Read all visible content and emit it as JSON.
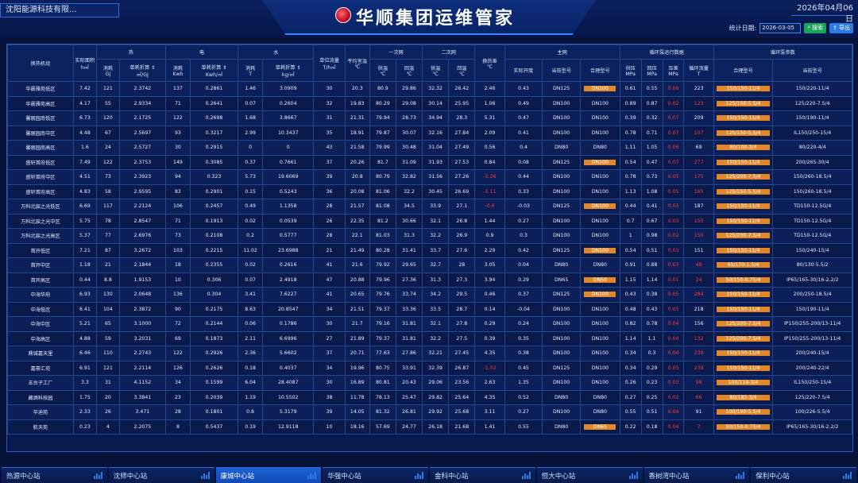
{
  "header": {
    "company": "沈阳能源科技有限...",
    "title": "华顺集团运维管家",
    "date": "2026年04月06日"
  },
  "filter": {
    "label": "统计日期:",
    "date_value": "2026-03-05",
    "search_label": "搜索",
    "export_label": "导出"
  },
  "table": {
    "headers": {
      "station": "换热机组",
      "area": "实际面积",
      "area_unit": "h㎡",
      "heat": "热",
      "elec": "电",
      "water": "水",
      "unit_flow": "单位流量",
      "unit_flow_unit": "T/h㎡",
      "avg_temp": "平均室温",
      "avg_temp_unit": "℃",
      "primary": "一次网",
      "secondary": "二次网",
      "temp_diff": "换热差",
      "temp_diff_unit": "℃",
      "main_net": "主网",
      "pump_run": "循环泵运行数据",
      "pump_param": "循环泵参数",
      "heat_cons": "消耗",
      "heat_cons_unit": "GJ",
      "heat_unit": "单耗折算",
      "heat_unit_unit": "㎡/GJ",
      "elec_cons": "消耗",
      "elec_cons_unit": "Kwh",
      "elec_unit": "单耗折算",
      "elec_unit_unit": "Kwh/㎡",
      "water_cons": "消耗",
      "water_cons_unit": "T",
      "water_unit": "单耗折算",
      "water_unit_unit": "kg/㎡",
      "p_supply": "供温",
      "p_supply_unit": "℃",
      "p_return": "回温",
      "p_return_unit": "℃",
      "s_supply": "供温",
      "s_supply_unit": "℃",
      "s_return": "回温",
      "s_return_unit": "℃",
      "valve_open": "实际开度",
      "current_model": "当前型号",
      "proper_model": "合理型号",
      "out_press": "供压",
      "out_press_unit": "MPa",
      "ret_press": "回压",
      "ret_press_unit": "MPa",
      "diff_press": "压差",
      "diff_press_unit": "MPa",
      "flow": "循环流量",
      "flow_unit": "T",
      "pump_proper": "合理型号",
      "pump_current": "当前型号"
    },
    "rows": [
      {
        "name": "华晨雅苑低区",
        "area": "7.42",
        "hc": "121",
        "hu": "2.3742",
        "ec": "137",
        "eu": "0.2861",
        "wc": "1.46",
        "wu": "3.0909",
        "uf": "30",
        "at": "20.3",
        "ps": "80.9",
        "pr": "29.86",
        "ss": "32.32",
        "sr": "26.42",
        "td": "2.46",
        "vo": "0.43",
        "cm": "DN125",
        "pm": "DN100",
        "op": "0.61",
        "rp": "0.55",
        "dp": "0.06",
        "fl": "223",
        "pp": "150/150-11/4",
        "pc": "150/220-11/4",
        "orange_pm": true,
        "red_td": false,
        "red_dp": true,
        "red_fl": false
      },
      {
        "name": "华晨雅苑高区",
        "area": "4.17",
        "hc": "55",
        "hu": "2.9334",
        "ec": "71",
        "eu": "0.2641",
        "wc": "0.07",
        "wu": "0.2604",
        "uf": "32",
        "at": "19.83",
        "ps": "80.29",
        "pr": "29.08",
        "ss": "30.14",
        "sr": "25.95",
        "td": "1.06",
        "vo": "0.49",
        "cm": "DN100",
        "pm": "DN100",
        "op": "0.89",
        "rp": "0.87",
        "dp": "0.02",
        "fl": "123",
        "pp": "125/150-5.5/4",
        "pc": "125/220-7.5/4",
        "orange_pm": false,
        "red_td": false,
        "red_dp": true,
        "red_fl": true
      },
      {
        "name": "馨丽园南低区",
        "area": "6.73",
        "hc": "120",
        "hu": "2.1725",
        "ec": "122",
        "eu": "0.2698",
        "wc": "1.68",
        "wu": "3.8667",
        "uf": "31",
        "at": "21.31",
        "ps": "79.94",
        "pr": "28.73",
        "ss": "34.94",
        "sr": "28.3",
        "td": "5.31",
        "vo": "0.47",
        "cm": "DN100",
        "pm": "DN100",
        "op": "0.39",
        "rp": "0.32",
        "dp": "0.07",
        "fl": "209",
        "pp": "150/150-11/4",
        "pc": "150/190-11/4",
        "orange_pm": false,
        "red_td": false,
        "red_dp": true,
        "red_fl": false
      },
      {
        "name": "馨丽园南中区",
        "area": "4.48",
        "hc": "67",
        "hu": "2.5697",
        "ec": "93",
        "eu": "0.3217",
        "wc": "2.99",
        "wu": "10.3437",
        "uf": "35",
        "at": "18.91",
        "ps": "79.87",
        "pr": "30.07",
        "ss": "32.16",
        "sr": "27.84",
        "td": "2.09",
        "vo": "0.41",
        "cm": "DN100",
        "pm": "DN100",
        "op": "0.78",
        "rp": "0.71",
        "dp": "0.07",
        "fl": "107",
        "pp": "125/150-5.5/4",
        "pc": "IL150/250-15/4",
        "orange_pm": false,
        "red_td": false,
        "red_dp": true,
        "red_fl": true
      },
      {
        "name": "馨丽园南高区",
        "area": "1.6",
        "hc": "24",
        "hu": "2.5727",
        "ec": "30",
        "eu": "0.2915",
        "wc": "0",
        "wu": "0",
        "uf": "43",
        "at": "21.58",
        "ps": "79.99",
        "pr": "30.48",
        "ss": "31.04",
        "sr": "27.49",
        "td": "0.56",
        "vo": "0.4",
        "cm": "DN80",
        "pm": "DN80",
        "op": "1.11",
        "rp": "1.05",
        "dp": "0.06",
        "fl": "69",
        "pp": "80/100-3/4",
        "pc": "80/220-4/4",
        "orange_pm": false,
        "red_td": false,
        "red_dp": true,
        "red_fl": false
      },
      {
        "name": "盛轩首府低区",
        "area": "7.49",
        "hc": "122",
        "hu": "2.3753",
        "ec": "149",
        "eu": "0.3085",
        "wc": "0.37",
        "wu": "0.7661",
        "uf": "37",
        "at": "20.26",
        "ps": "81.7",
        "pr": "31.09",
        "ss": "31.93",
        "sr": "27.53",
        "td": "0.84",
        "vo": "0.08",
        "cm": "DN125",
        "pm": "DN100",
        "op": "0.54",
        "rp": "0.47",
        "dp": "0.07",
        "fl": "277",
        "pp": "150/150-11/4",
        "pc": "200/265-30/4",
        "orange_pm": true,
        "red_td": false,
        "red_dp": true,
        "red_fl": true
      },
      {
        "name": "盛轩首府中区",
        "area": "4.51",
        "hc": "73",
        "hu": "2.3923",
        "ec": "94",
        "eu": "0.323",
        "wc": "5.73",
        "wu": "19.6069",
        "uf": "39",
        "at": "20.8",
        "ps": "80.79",
        "pr": "32.82",
        "ss": "31.56",
        "sr": "27.26",
        "td": "-1.26",
        "vo": "0.44",
        "cm": "DN100",
        "pm": "DN100",
        "op": "0.78",
        "rp": "0.73",
        "dp": "0.05",
        "fl": "175",
        "pp": "125/200-7.5/4",
        "pc": "150/260-18.5/4",
        "orange_pm": false,
        "red_td": true,
        "red_dp": true,
        "red_fl": true
      },
      {
        "name": "盛轩首府高区",
        "area": "4.83",
        "hc": "58",
        "hu": "2.9595",
        "ec": "83",
        "eu": "0.2901",
        "wc": "0.15",
        "wu": "0.5243",
        "uf": "36",
        "at": "20.08",
        "ps": "81.06",
        "pr": "32.2",
        "ss": "30.45",
        "sr": "26.69",
        "td": "-1.11",
        "vo": "0.33",
        "cm": "DN100",
        "pm": "DN100",
        "op": "1.13",
        "rp": "1.08",
        "dp": "0.05",
        "fl": "165",
        "pp": "125/150-5.5/4",
        "pc": "150/260-18.5/4",
        "orange_pm": false,
        "red_td": true,
        "red_dp": true,
        "red_fl": true
      },
      {
        "name": "万科北宸之光低区",
        "area": "6.69",
        "hc": "117",
        "hu": "2.2124",
        "ec": "106",
        "eu": "0.2457",
        "wc": "0.49",
        "wu": "1.1358",
        "uf": "28",
        "at": "21.57",
        "ps": "81.08",
        "pr": "34.5",
        "ss": "33.9",
        "sr": "27.1",
        "td": "-0.6",
        "vo": "-0.03",
        "cm": "DN125",
        "pm": "DN100",
        "op": "0.44",
        "rp": "0.41",
        "dp": "0.03",
        "fl": "187",
        "pp": "150/150-11/4",
        "pc": "TD150-12.5G/4",
        "orange_pm": true,
        "red_td": true,
        "red_dp": true,
        "red_fl": false
      },
      {
        "name": "万科北宸之光中区",
        "area": "5.75",
        "hc": "78",
        "hu": "2.8547",
        "ec": "71",
        "eu": "0.1913",
        "wc": "0.02",
        "wu": "0.0539",
        "uf": "26",
        "at": "22.35",
        "ps": "81.2",
        "pr": "30.66",
        "ss": "32.1",
        "sr": "26.8",
        "td": "1.44",
        "vo": "0.27",
        "cm": "DN100",
        "pm": "DN100",
        "op": "0.7",
        "rp": "0.67",
        "dp": "0.03",
        "fl": "155",
        "pp": "150/150-11/4",
        "pc": "TD150-12.5G/4",
        "orange_pm": false,
        "red_td": false,
        "red_dp": true,
        "red_fl": true
      },
      {
        "name": "万科北宸之光高区",
        "area": "5.37",
        "hc": "77",
        "hu": "2.6976",
        "ec": "73",
        "eu": "0.2108",
        "wc": "0.2",
        "wu": "0.5777",
        "uf": "28",
        "at": "22.1",
        "ps": "81.03",
        "pr": "31.3",
        "ss": "32.2",
        "sr": "26.9",
        "td": "0.9",
        "vo": "0.3",
        "cm": "DN100",
        "pm": "DN100",
        "op": "1",
        "rp": "0.98",
        "dp": "0.02",
        "fl": "150",
        "pp": "125/200-7.5/4",
        "pc": "TD150-12.5G/4",
        "orange_pm": false,
        "red_td": false,
        "red_dp": true,
        "red_fl": true
      },
      {
        "name": "首开低区",
        "area": "7.21",
        "hc": "87",
        "hu": "3.2672",
        "ec": "103",
        "eu": "0.2215",
        "wc": "11.02",
        "wu": "23.6988",
        "uf": "21",
        "at": "21.49",
        "ps": "80.28",
        "pr": "31.41",
        "ss": "33.7",
        "sr": "27.6",
        "td": "2.29",
        "vo": "0.42",
        "cm": "DN125",
        "pm": "DN100",
        "op": "0.54",
        "rp": "0.51",
        "dp": "0.03",
        "fl": "151",
        "pp": "150/150-11/4",
        "pc": "150/240-15/4",
        "orange_pm": true,
        "red_td": false,
        "red_dp": true,
        "red_fl": false
      },
      {
        "name": "首开中区",
        "area": "1.18",
        "hc": "21",
        "hu": "2.1844",
        "ec": "18",
        "eu": "0.2355",
        "wc": "0.02",
        "wu": "0.2616",
        "uf": "41",
        "at": "21.6",
        "ps": "79.92",
        "pr": "29.65",
        "ss": "32.7",
        "sr": "28",
        "td": "3.05",
        "vo": "0.04",
        "cm": "DN80",
        "pm": "DN80",
        "op": "0.91",
        "rp": "0.88",
        "dp": "0.03",
        "fl": "48",
        "pp": "65/170-1.5/4",
        "pc": "80/130-5.5/2",
        "orange_pm": false,
        "red_td": false,
        "red_dp": true,
        "red_fl": true
      },
      {
        "name": "首开高区",
        "area": "0.44",
        "hc": "8.8",
        "hu": "1.9153",
        "ec": "10",
        "eu": "0.306",
        "wc": "0.07",
        "wu": "2.4918",
        "uf": "47",
        "at": "20.88",
        "ps": "79.96",
        "pr": "27.36",
        "ss": "31.3",
        "sr": "27.3",
        "td": "3.94",
        "vo": "0.29",
        "cm": "DN65",
        "pm": "DN50",
        "op": "1.15",
        "rp": "1.14",
        "dp": "0.01",
        "fl": "24",
        "pp": "50/150-0.75/4",
        "pc": "IP65/165-30/16-2.2/2",
        "orange_pm": true,
        "red_td": false,
        "red_dp": true,
        "red_fl": true
      },
      {
        "name": "中海华府",
        "area": "6.93",
        "hc": "130",
        "hu": "2.0648",
        "ec": "136",
        "eu": "0.304",
        "wc": "3.41",
        "wu": "7.6227",
        "uf": "41",
        "at": "20.65",
        "ps": "79.76",
        "pr": "33.74",
        "ss": "34.2",
        "sr": "29.5",
        "td": "0.46",
        "vo": "0.37",
        "cm": "DN125",
        "pm": "DN100",
        "op": "0.43",
        "rp": "0.38",
        "dp": "0.05",
        "fl": "284",
        "pp": "150/150-11/4",
        "pc": "200/250-18.5/4",
        "orange_pm": true,
        "red_td": false,
        "red_dp": true,
        "red_fl": true
      },
      {
        "name": "中海低区",
        "area": "6.41",
        "hc": "104",
        "hu": "2.3872",
        "ec": "90",
        "eu": "0.2175",
        "wc": "8.63",
        "wu": "20.8547",
        "uf": "34",
        "at": "21.51",
        "ps": "79.37",
        "pr": "33.36",
        "ss": "33.5",
        "sr": "28.7",
        "td": "0.14",
        "vo": "-0.04",
        "cm": "DN100",
        "pm": "DN100",
        "op": "0.48",
        "rp": "0.43",
        "dp": "0.05",
        "fl": "218",
        "pp": "150/150-11/4",
        "pc": "150/190-11/4",
        "orange_pm": false,
        "red_td": false,
        "red_dp": true,
        "red_fl": false
      },
      {
        "name": "中海中区",
        "area": "5.21",
        "hc": "65",
        "hu": "3.1000",
        "ec": "72",
        "eu": "0.2144",
        "wc": "0.06",
        "wu": "0.1786",
        "uf": "30",
        "at": "21.7",
        "ps": "79.16",
        "pr": "31.81",
        "ss": "32.1",
        "sr": "27.8",
        "td": "0.29",
        "vo": "0.24",
        "cm": "DN100",
        "pm": "DN100",
        "op": "0.82",
        "rp": "0.78",
        "dp": "0.04",
        "fl": "156",
        "pp": "125/200-7.5/4",
        "pc": "IP150/255-200/13-11/4",
        "orange_pm": false,
        "red_td": false,
        "red_dp": true,
        "red_fl": false
      },
      {
        "name": "中海高区",
        "area": "4.88",
        "hc": "59",
        "hu": "3.2031",
        "ec": "69",
        "eu": "0.1873",
        "wc": "2.11",
        "wu": "6.6996",
        "uf": "27",
        "at": "21.89",
        "ps": "79.37",
        "pr": "31.81",
        "ss": "32.2",
        "sr": "27.5",
        "td": "0.39",
        "vo": "0.35",
        "cm": "DN100",
        "pm": "DN100",
        "op": "1.14",
        "rp": "1.1",
        "dp": "0.04",
        "fl": "132",
        "pp": "125/200-7.5/4",
        "pc": "IP150/255-200/13-11/4",
        "orange_pm": false,
        "red_td": false,
        "red_dp": true,
        "red_fl": true
      },
      {
        "name": "鼎城嘉天里",
        "area": "6.46",
        "hc": "110",
        "hu": "2.2743",
        "ec": "122",
        "eu": "0.2926",
        "wc": "2.36",
        "wu": "5.6602",
        "uf": "37",
        "at": "20.71",
        "ps": "77.63",
        "pr": "27.86",
        "ss": "32.21",
        "sr": "27.45",
        "td": "4.35",
        "vo": "0.38",
        "cm": "DN100",
        "pm": "DN100",
        "op": "0.34",
        "rp": "0.3",
        "dp": "0.04",
        "fl": "239",
        "pp": "150/150-11/4",
        "pc": "200/240-15/4",
        "orange_pm": false,
        "red_td": false,
        "red_dp": true,
        "red_fl": true
      },
      {
        "name": "嘉豪汇苑",
        "area": "6.91",
        "hc": "121",
        "hu": "2.2114",
        "ec": "126",
        "eu": "0.2626",
        "wc": "0.18",
        "wu": "0.4037",
        "uf": "34",
        "at": "19.96",
        "ps": "80.75",
        "pr": "33.91",
        "ss": "32.39",
        "sr": "26.87",
        "td": "-1.02",
        "vo": "0.45",
        "cm": "DN125",
        "pm": "DN100",
        "op": "0.34",
        "rp": "0.29",
        "dp": "0.05",
        "fl": "239",
        "pp": "150/150-11/4",
        "pc": "200/240-22/4",
        "orange_pm": false,
        "red_td": true,
        "red_dp": true,
        "red_fl": true
      },
      {
        "name": "五台子工厂",
        "area": "3.3",
        "hc": "31",
        "hu": "4.1152",
        "ec": "34",
        "eu": "0.1599",
        "wc": "6.04",
        "wu": "28.4087",
        "uf": "30",
        "at": "16.89",
        "ps": "80.81",
        "pr": "20.43",
        "ss": "29.06",
        "sr": "23.56",
        "td": "2.63",
        "vo": "1.35",
        "cm": "DN100",
        "pm": "DN100",
        "op": "0.26",
        "rp": "0.23",
        "dp": "0.03",
        "fl": "98",
        "pp": "100/118-3/4",
        "pc": "IL150/250-15/4",
        "orange_pm": false,
        "red_td": false,
        "red_dp": true,
        "red_fl": true
      },
      {
        "name": "藏酒科技园",
        "area": "1.75",
        "hc": "20",
        "hu": "3.3841",
        "ec": "23",
        "eu": "0.2039",
        "wc": "1.19",
        "wu": "10.5502",
        "uf": "38",
        "at": "11.78",
        "ps": "78.13",
        "pr": "25.47",
        "ss": "29.82",
        "sr": "25.64",
        "td": "4.35",
        "vo": "0.52",
        "cm": "DN80",
        "pm": "DN80",
        "op": "0.27",
        "rp": "0.25",
        "dp": "0.02",
        "fl": "66",
        "pp": "80/185-3/4",
        "pc": "125/220-7.5/4",
        "orange_pm": false,
        "red_td": false,
        "red_dp": true,
        "red_fl": true
      },
      {
        "name": "华迪苑",
        "area": "2.33",
        "hc": "26",
        "hu": "3.471",
        "ec": "28",
        "eu": "0.1801",
        "wc": "0.8",
        "wu": "5.3179",
        "uf": "39",
        "at": "14.05",
        "ps": "81.32",
        "pr": "26.81",
        "ss": "29.92",
        "sr": "25.68",
        "td": "3.11",
        "vo": "0.27",
        "cm": "DN100",
        "pm": "DN80",
        "op": "0.55",
        "rp": "0.51",
        "dp": "0.04",
        "fl": "91",
        "pp": "100/190-5.5/4",
        "pc": "100/226-5.5/4",
        "orange_pm": false,
        "red_td": false,
        "red_dp": true,
        "red_fl": false
      },
      {
        "name": "航天苑",
        "area": "0.23",
        "hc": "4",
        "hu": "2.2075",
        "ec": "8",
        "eu": "0.5437",
        "wc": "0.19",
        "wu": "12.9118",
        "uf": "10",
        "at": "18.16",
        "ps": "57.69",
        "pr": "24.77",
        "ss": "26.18",
        "sr": "21.68",
        "td": "1.41",
        "vo": "0.55",
        "cm": "DN80",
        "pm": "DN65",
        "op": "0.22",
        "rp": "0.18",
        "dp": "0.04",
        "fl": "7",
        "pp": "50/150-0.75/4",
        "pc": "IP65/165-30/16-2.2/2",
        "orange_pm": true,
        "red_td": false,
        "red_dp": true,
        "red_fl": true
      }
    ]
  },
  "tabs": [
    {
      "label": "热源中心站",
      "active": false
    },
    {
      "label": "沈师中心站",
      "active": false
    },
    {
      "label": "康城中心站",
      "active": true
    },
    {
      "label": "华强中心站",
      "active": false
    },
    {
      "label": "金科中心站",
      "active": false
    },
    {
      "label": "恒大中心站",
      "active": false
    },
    {
      "label": "香树湾中心站",
      "active": false
    },
    {
      "label": "保利中心站",
      "active": false
    }
  ],
  "colors": {
    "bg": "#061238",
    "accent": "#2c7be5",
    "warn": "#e2872a",
    "alert": "#ff3b3b",
    "ok": "#1aa35a"
  }
}
